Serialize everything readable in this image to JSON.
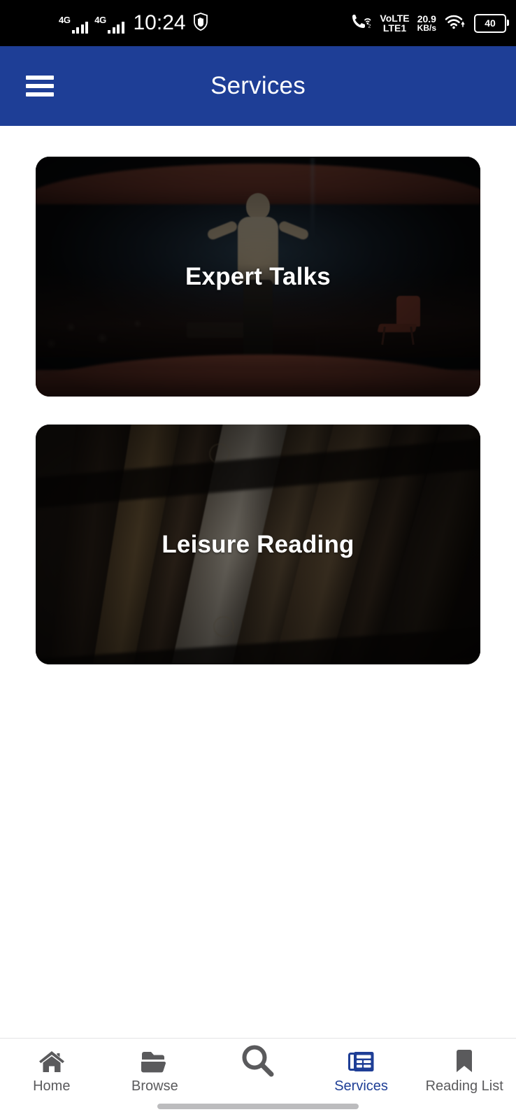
{
  "status_bar": {
    "network_1": "4G",
    "network_2": "4G",
    "time": "10:24",
    "do_not_disturb_icon": "hand-shield-icon",
    "call_icon": "call-wifi-icon",
    "volte_line_1": "VoLTE",
    "volte_line_2": "LTE1",
    "net_speed_value": "20.9",
    "net_speed_unit": "KB/s",
    "wifi_icon": "wifi-icon",
    "battery_level": "40"
  },
  "app_bar": {
    "menu_icon": "hamburger-menu-icon",
    "title": "Services"
  },
  "main": {
    "cards": [
      {
        "label": "Expert Talks",
        "art": "conference-stage-photo"
      },
      {
        "label": "Leisure Reading",
        "art": "old-books-photo"
      }
    ]
  },
  "bottom_nav": {
    "active_color": "#1E3E96",
    "inactive_color": "#5A5A5C",
    "items": [
      {
        "label": "Home",
        "icon": "home-icon",
        "active": false
      },
      {
        "label": "Browse",
        "icon": "folder-icon",
        "active": false
      },
      {
        "label": "",
        "icon": "search-icon",
        "active": false
      },
      {
        "label": "Services",
        "icon": "articles-icon",
        "active": true
      },
      {
        "label": "Reading List",
        "icon": "bookmark-icon",
        "active": false
      }
    ]
  }
}
